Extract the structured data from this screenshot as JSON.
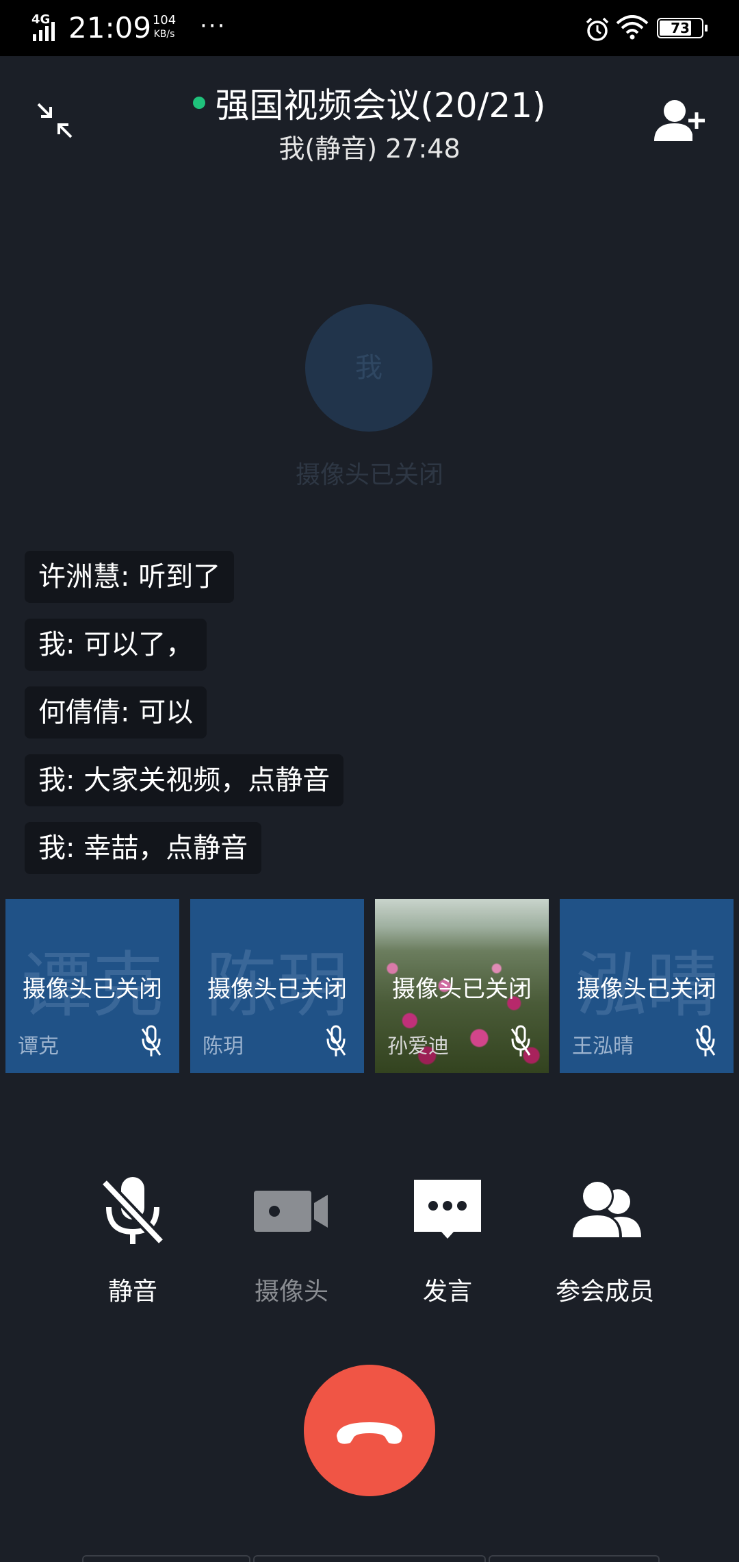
{
  "status_bar": {
    "network": "4G",
    "time": "21:09",
    "speed_value": "104",
    "speed_unit": "KB/s",
    "more": "···",
    "battery": "73"
  },
  "header": {
    "title": "强国视频会议(20/21)",
    "subtitle": "我(静音) 27:48",
    "status_color": "#1fc17b"
  },
  "self_view": {
    "avatar_text": "我",
    "camera_off_text": "摄像头已关闭"
  },
  "chat": [
    "许洲慧: 听到了",
    "我: 可以了，",
    "何倩倩: 可以",
    "我: 大家关视频，点静音",
    "我: 幸喆，点静音"
  ],
  "participants": [
    {
      "bg_name": "谭克",
      "camera_off": "摄像头已关闭",
      "name": "谭克",
      "muted": true
    },
    {
      "bg_name": "陈玥",
      "camera_off": "摄像头已关闭",
      "name": "陈玥",
      "muted": true
    },
    {
      "bg_name": "",
      "camera_off": "摄像头已关闭",
      "name": "孙爱迪",
      "muted": true
    },
    {
      "bg_name": "泓晴",
      "camera_off": "摄像头已关闭",
      "name": "王泓晴",
      "muted": true
    }
  ],
  "controls": {
    "mute": "静音",
    "camera": "摄像头",
    "speak": "发言",
    "members": "参会成员"
  },
  "colors": {
    "background": "#1b1f27",
    "tile": "#205287",
    "hangup": "#f05545"
  }
}
